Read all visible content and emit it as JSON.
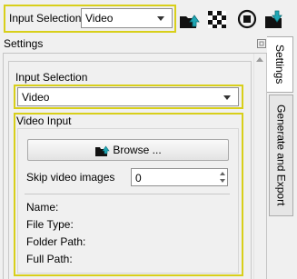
{
  "toolbar": {
    "input_selection_label": "Input Selection:",
    "input_selection_value": "Video",
    "buttons": [
      {
        "icon": "upload-folder-icon",
        "name": "open-button"
      },
      {
        "icon": "checker-pattern-icon",
        "name": "pattern-button"
      },
      {
        "icon": "stop-circle-icon",
        "name": "stop-button"
      },
      {
        "icon": "download-folder-icon",
        "name": "save-button"
      }
    ]
  },
  "settings": {
    "title": "Settings",
    "input_selection": {
      "label": "Input Selection",
      "value": "Video"
    },
    "video_input": {
      "label": "Video Input",
      "browse_label": "Browse ...",
      "skip_label": "Skip video images",
      "skip_value": "0",
      "info_labels": [
        "Name:",
        "File Type:",
        "Folder Path:",
        "Full Path:"
      ]
    }
  },
  "tabs": [
    "Settings",
    "Generate and Export"
  ],
  "colors": {
    "highlight": "#d8cf1a",
    "icon_teal": "#1fa7b5"
  }
}
